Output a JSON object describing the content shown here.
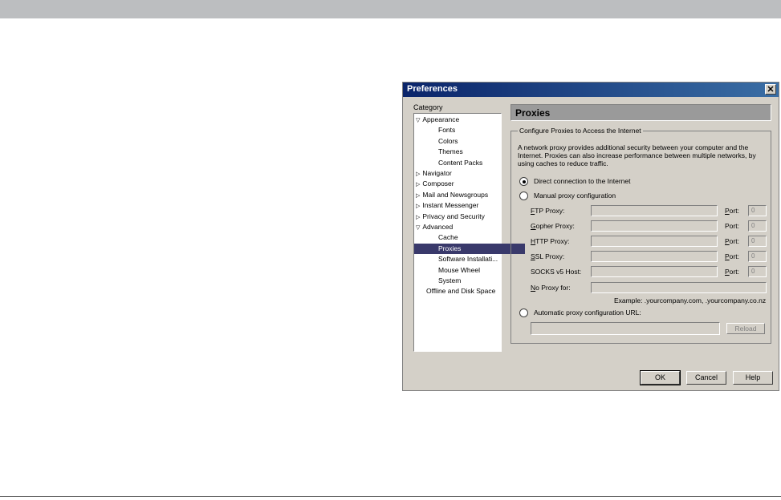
{
  "dialog": {
    "title": "Preferences",
    "close_glyph": "✕",
    "category_label": "Category"
  },
  "tree": [
    {
      "label": "Appearance",
      "level": 0,
      "expander": "▽"
    },
    {
      "label": "Fonts",
      "level": 1
    },
    {
      "label": "Colors",
      "level": 1
    },
    {
      "label": "Themes",
      "level": 1
    },
    {
      "label": "Content Packs",
      "level": 1
    },
    {
      "label": "Navigator",
      "level": 0,
      "expander": "▷"
    },
    {
      "label": "Composer",
      "level": 0,
      "expander": "▷"
    },
    {
      "label": "Mail and Newsgroups",
      "level": 0,
      "expander": "▷"
    },
    {
      "label": "Instant Messenger",
      "level": 0,
      "expander": "▷"
    },
    {
      "label": "Privacy and Security",
      "level": 0,
      "expander": "▷"
    },
    {
      "label": "Advanced",
      "level": 0,
      "expander": "▽"
    },
    {
      "label": "Cache",
      "level": 1
    },
    {
      "label": "Proxies",
      "level": 1,
      "selected": true
    },
    {
      "label": "Software Installati...",
      "level": 1
    },
    {
      "label": "Mouse Wheel",
      "level": 1
    },
    {
      "label": "System",
      "level": 1
    },
    {
      "label": "Offline and Disk Space",
      "level": 0
    }
  ],
  "panel": {
    "title": "Proxies",
    "group_legend": "Configure Proxies to Access the Internet",
    "description": "A network proxy provides additional security between your computer and the Internet. Proxies can also increase performance between multiple networks, by using caches to reduce traffic.",
    "radio_direct": "Direct connection to the Internet",
    "radio_manual": "Manual proxy configuration",
    "radio_auto": "Automatic proxy configuration URL:",
    "selected_option": "direct",
    "fields": [
      {
        "accel": "F",
        "rest": "TP Proxy:",
        "port_label_accel": "P",
        "port_label_rest": "ort:",
        "port_value": "0"
      },
      {
        "accel": "G",
        "rest": "opher Proxy:",
        "port_label_accel": "",
        "port_label_rest": "Port:",
        "port_value": "0"
      },
      {
        "accel": "H",
        "rest": "TTP Proxy:",
        "port_label_accel": "P",
        "port_label_rest": "ort:",
        "port_value": "0"
      },
      {
        "accel": "S",
        "rest": "SL Proxy:",
        "port_label_accel": "P",
        "port_label_rest": "ort:",
        "port_value": "0"
      },
      {
        "accel": "",
        "rest": "SOCKS v5 Host:",
        "port_label_accel": "P",
        "port_label_rest": "ort:",
        "port_value": "0"
      }
    ],
    "no_proxy_accel": "N",
    "no_proxy_rest": "o Proxy for:",
    "example": "Example: .yourcompany.com, .yourcompany.co.nz",
    "reload_label": "Reload"
  },
  "buttons": {
    "ok": "OK",
    "cancel": "Cancel",
    "help": "Help"
  }
}
